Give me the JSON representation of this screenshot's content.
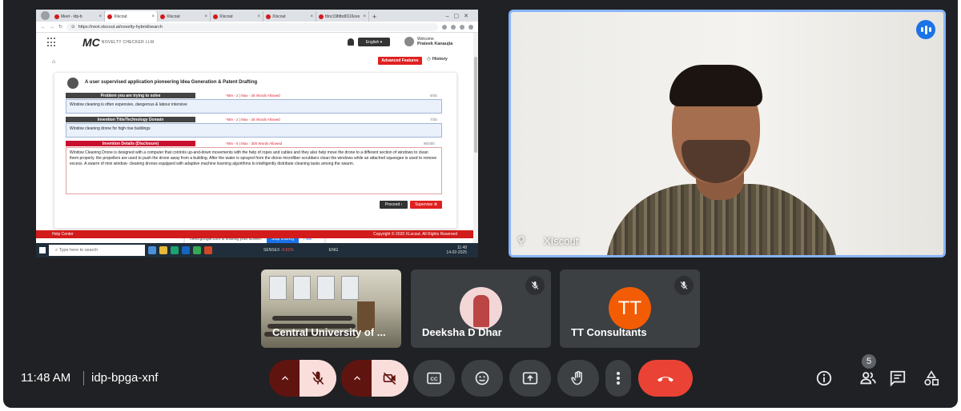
{
  "meeting": {
    "time": "11:48 AM",
    "code": "idp-bpga-xnf",
    "participant_count": "5"
  },
  "presentation": {
    "browser": {
      "tabs": [
        {
          "label": "Meet - idp-b"
        },
        {
          "label": "XIscout"
        },
        {
          "label": "XIscout"
        },
        {
          "label": "XIscout"
        },
        {
          "label": "XIscout"
        },
        {
          "label": "fdoc19fdbd0116ces"
        }
      ],
      "url": "https://next.xlscout.ai/novelty-hybrid/search"
    },
    "site": {
      "logo_text": "NOVELTY CHECKER LLM",
      "language": "English",
      "welcome_label": "Welcome",
      "user_name": "Prateek Kanaujia",
      "advanced_features_label": "Advanced Features",
      "history_label": "History",
      "card_title": "A user supervised application pioneering Idea Generation & Patent Drafting",
      "fields": [
        {
          "label": "Problem you are trying to solve",
          "limit": "*Min - 2 | Max - 25 Words Allowed",
          "count": "9/25",
          "value": "Window cleaning is often expensive, dangerous & labour intensive"
        },
        {
          "label": "Invention Title/Technology Domain",
          "limit": "*Min - 2 | Max - 25 Words Allowed",
          "count": "7/25",
          "value": "Window cleaning drone for high rise buildings"
        },
        {
          "label": "Invention Details (Disclosure)",
          "limit": "*Min - 5 | Max - 300 Words Allowed",
          "count": "90/300",
          "value": "Window Cleaning Drone is designed with a computer that controls up-and-down movements with the help of ropes and cables and they also help move the drone to a different section of windows to clean them properly. the propellers are used to push the drone away from a building. After the water is sprayed from the drone microfiber scrubbers clean the windows while an attached squeegee is used to remove excess. A swarm of mini window- cleaning drones equipped with adaptive machine learning algorithms to intelligently distribute cleaning tasks among the swarm."
        }
      ],
      "proceed_label": "Proceed",
      "supervise_label": "Supervise",
      "share_message": "meet.google.com is sharing your screen.",
      "stop_sharing_label": "Stop sharing",
      "hide_label": "Hide",
      "help_center_label": "Help Center",
      "copyright": "Copyright © 2020 XLscout. All Rights Reserved"
    },
    "taskbar": {
      "search_placeholder": "Type here to search",
      "ticker_label": "SENSEX",
      "ticker_change": "-0.61%",
      "lang": "ENG",
      "clock_time": "11:48",
      "clock_date": "14-02-2025"
    }
  },
  "speaker": {
    "name": "XIscout"
  },
  "participants": [
    {
      "name": "Central University of ..."
    },
    {
      "name": "Deeksha D Dhar"
    },
    {
      "name": "TT Consultants",
      "initials": "TT"
    }
  ],
  "colors": {
    "meet_bg": "#202124",
    "tile_bg": "#3c4043",
    "speaker_border": "#8ab4f8",
    "end_call": "#ea4335",
    "muted_bg": "#f9dedc",
    "muted_dark": "#601410",
    "avatar_tt": "#f25c05",
    "site_red": "#d21b1b"
  }
}
